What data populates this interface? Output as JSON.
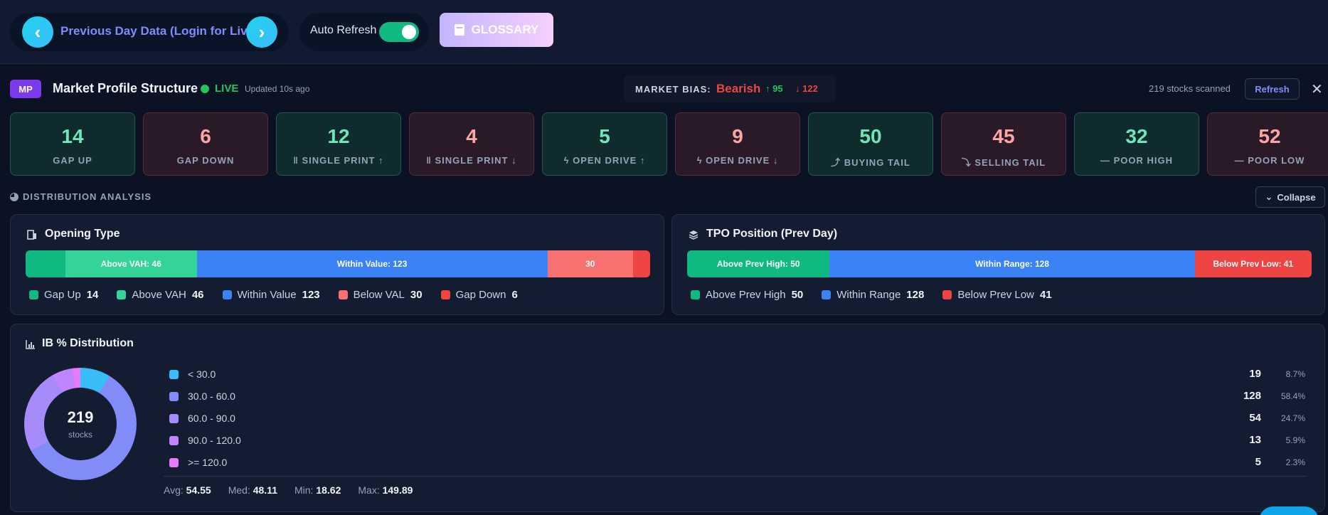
{
  "topbar": {
    "prev_label": "Previous Day Data (Login for Live)",
    "auto_refresh_label": "Auto Refresh",
    "auto_refresh_on": true,
    "glossary_label": "GLOSSARY"
  },
  "header": {
    "badge": "MP",
    "title": "Market Profile Structure",
    "live": "LIVE",
    "updated": "Updated 10s ago",
    "bias_label": "MARKET BIAS:",
    "bias_value": "Bearish",
    "bias_up": "95",
    "bias_down": "122",
    "scanned": "219 stocks scanned",
    "refresh_label": "Refresh",
    "close": "✕"
  },
  "cards": [
    {
      "num": "14",
      "label": "GAP UP",
      "tone": "g"
    },
    {
      "num": "6",
      "label": "GAP DOWN",
      "tone": "r"
    },
    {
      "num": "12",
      "label": "‖ SINGLE PRINT ↑",
      "tone": "g"
    },
    {
      "num": "4",
      "label": "‖ SINGLE PRINT ↓",
      "tone": "r"
    },
    {
      "num": "5",
      "label": "ϟ OPEN DRIVE ↑",
      "tone": "g"
    },
    {
      "num": "9",
      "label": "ϟ OPEN DRIVE ↓",
      "tone": "r"
    },
    {
      "num": "50",
      "label": "⤴ BUYING TAIL",
      "tone": "g"
    },
    {
      "num": "45",
      "label": "⤵ SELLING TAIL",
      "tone": "r"
    },
    {
      "num": "32",
      "label": "— POOR HIGH",
      "tone": "g"
    },
    {
      "num": "52",
      "label": "— POOR LOW",
      "tone": "r"
    }
  ],
  "distribution": {
    "heading": "DISTRIBUTION ANALYSIS",
    "collapse_label": "Collapse"
  },
  "opening_type": {
    "title": "Opening Type",
    "segments": [
      {
        "label": "",
        "value": 14,
        "color": "#10b981"
      },
      {
        "label": "Above VAH: 46",
        "value": 46,
        "color": "#34d399"
      },
      {
        "label": "Within Value: 123",
        "value": 123,
        "color": "#3b82f6"
      },
      {
        "label": "30",
        "value": 30,
        "color": "#f87171"
      },
      {
        "label": "",
        "value": 6,
        "color": "#ef4444"
      }
    ],
    "legend": [
      {
        "name": "Gap Up",
        "value": "14",
        "color": "#10b981"
      },
      {
        "name": "Above VAH",
        "value": "46",
        "color": "#34d399"
      },
      {
        "name": "Within Value",
        "value": "123",
        "color": "#3b82f6"
      },
      {
        "name": "Below VAL",
        "value": "30",
        "color": "#f87171"
      },
      {
        "name": "Gap Down",
        "value": "6",
        "color": "#ef4444"
      }
    ]
  },
  "tpo_position": {
    "title": "TPO Position (Prev Day)",
    "segments": [
      {
        "label": "Above Prev High: 50",
        "value": 50,
        "color": "#10b981"
      },
      {
        "label": "Within Range: 128",
        "value": 128,
        "color": "#3b82f6"
      },
      {
        "label": "Below Prev Low: 41",
        "value": 41,
        "color": "#ef4444"
      }
    ],
    "legend": [
      {
        "name": "Above Prev High",
        "value": "50",
        "color": "#10b981"
      },
      {
        "name": "Within Range",
        "value": "128",
        "color": "#3b82f6"
      },
      {
        "name": "Below Prev Low",
        "value": "41",
        "color": "#ef4444"
      }
    ]
  },
  "ib_distribution": {
    "title": "IB % Distribution",
    "total": "219",
    "total_unit": "stocks",
    "rows": [
      {
        "range": "< 30.0",
        "count": "19",
        "pct": "8.7%",
        "value": 19,
        "color": "#38bdf8"
      },
      {
        "range": "30.0 - 60.0",
        "count": "128",
        "pct": "58.4%",
        "value": 128,
        "color": "#818cf8"
      },
      {
        "range": "60.0 - 90.0",
        "count": "54",
        "pct": "24.7%",
        "value": 54,
        "color": "#a78bfa"
      },
      {
        "range": "90.0 - 120.0",
        "count": "13",
        "pct": "5.9%",
        "value": 13,
        "color": "#c084fc"
      },
      {
        "range": ">= 120.0",
        "count": "5",
        "pct": "2.3%",
        "value": 5,
        "color": "#e879f9"
      }
    ],
    "stats": {
      "avg_label": "Avg:",
      "avg": "54.55",
      "med_label": "Med:",
      "med": "48.11",
      "min_label": "Min:",
      "min": "18.62",
      "max_label": "Max:",
      "max": "149.89"
    }
  }
}
